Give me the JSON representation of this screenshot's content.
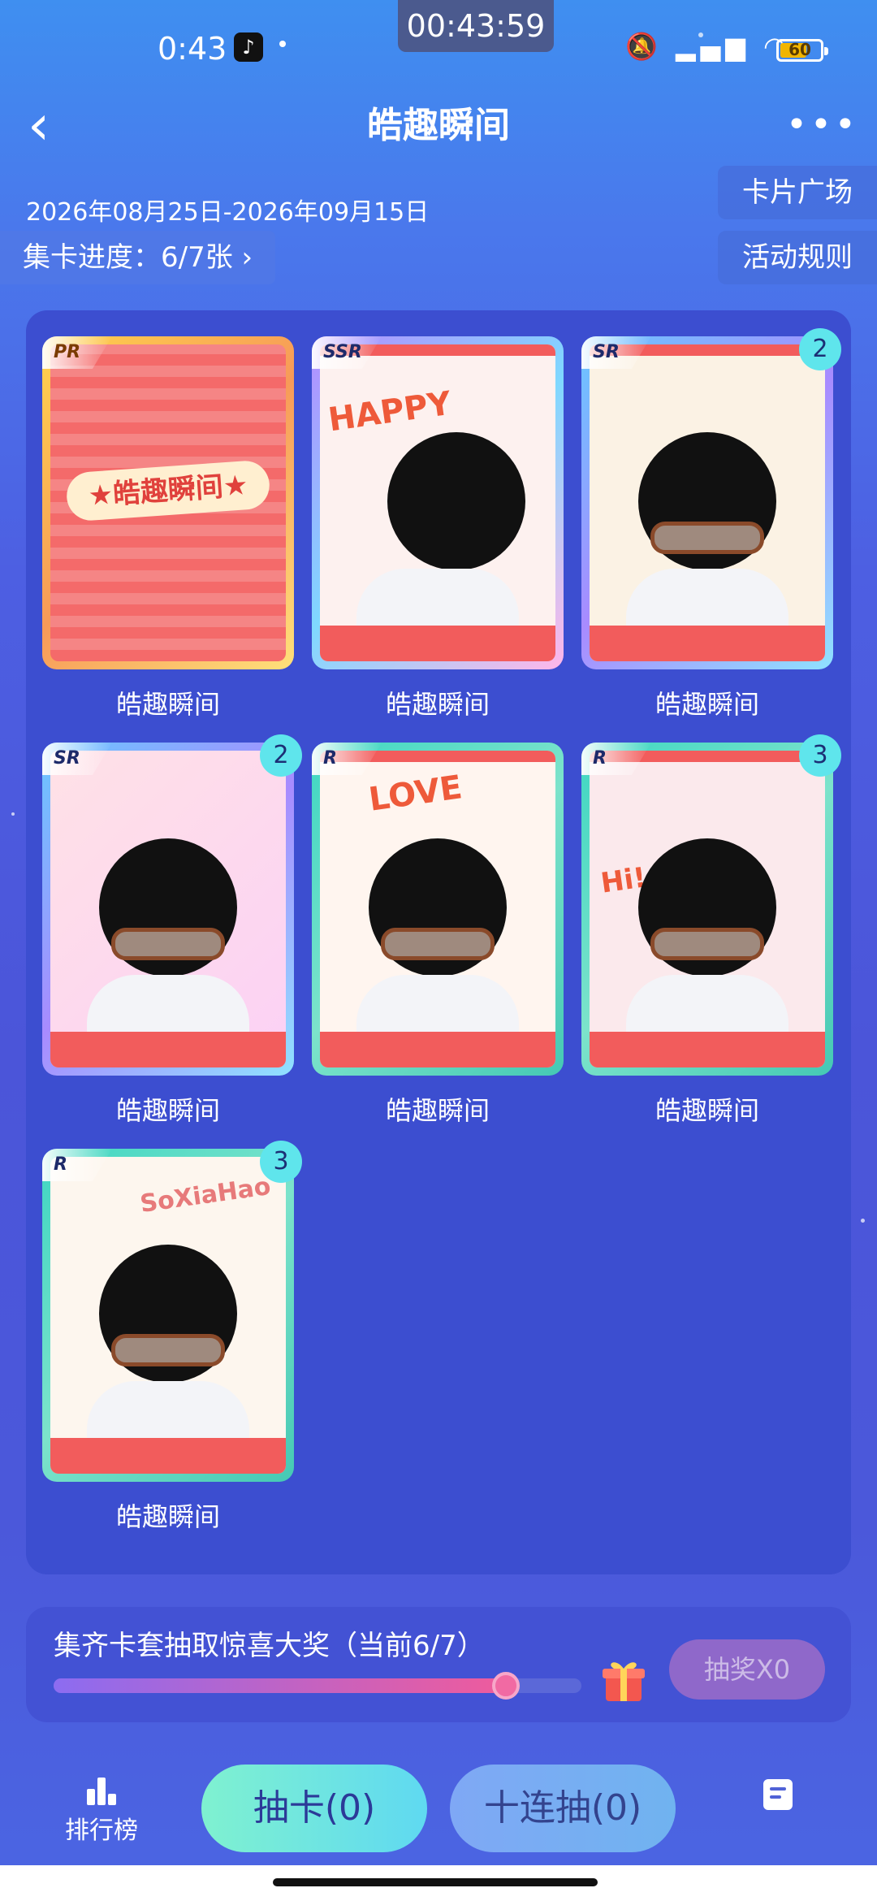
{
  "status_bar": {
    "time": "0:43",
    "app_icon": "tiktok-icon",
    "clock_overlay": "00:43:59",
    "battery": "60",
    "icons": [
      "mute-icon",
      "hd-signal-icon",
      "wifi-icon"
    ]
  },
  "header": {
    "title": "皓趣瞬间",
    "back_icon": "back-chevron-icon",
    "more_icon": "more-dots-icon"
  },
  "event": {
    "date_range": "2026年08月25日-2026年09月15日",
    "progress_label": "集卡进度：6/7张 ›"
  },
  "side_buttons": {
    "card_plaza": "卡片广场",
    "rules": "活动规则"
  },
  "cards": [
    {
      "rarity": "PR",
      "label": "皓趣瞬间",
      "count": ""
    },
    {
      "rarity": "SSR",
      "label": "皓趣瞬间",
      "count": ""
    },
    {
      "rarity": "SR",
      "label": "皓趣瞬间",
      "count": "2"
    },
    {
      "rarity": "SR",
      "label": "皓趣瞬间",
      "count": "2"
    },
    {
      "rarity": "R",
      "label": "皓趣瞬间",
      "count": ""
    },
    {
      "rarity": "R",
      "label": "皓趣瞬间",
      "count": "3"
    },
    {
      "rarity": "R",
      "label": "皓趣瞬间",
      "count": "3"
    }
  ],
  "card_art_text": {
    "ssr_art": "HAPPY",
    "r1_art": "LOVE",
    "r2_art": "Hi!",
    "r3_art": "SoXiaHao"
  },
  "lottery": {
    "title": "集齐卡套抽取惊喜大奖（当前6/7）",
    "progress_fraction": 0.857,
    "draw_button": "抽奖X0"
  },
  "footer": {
    "rank_label": "排行榜",
    "draw_one": "抽卡(0)",
    "draw_ten": "十连抽(0)"
  },
  "colors": {
    "accent_teal": "#5fe5ec",
    "accent_pink": "#ef5b9c",
    "panel": "#3c4ed0"
  }
}
